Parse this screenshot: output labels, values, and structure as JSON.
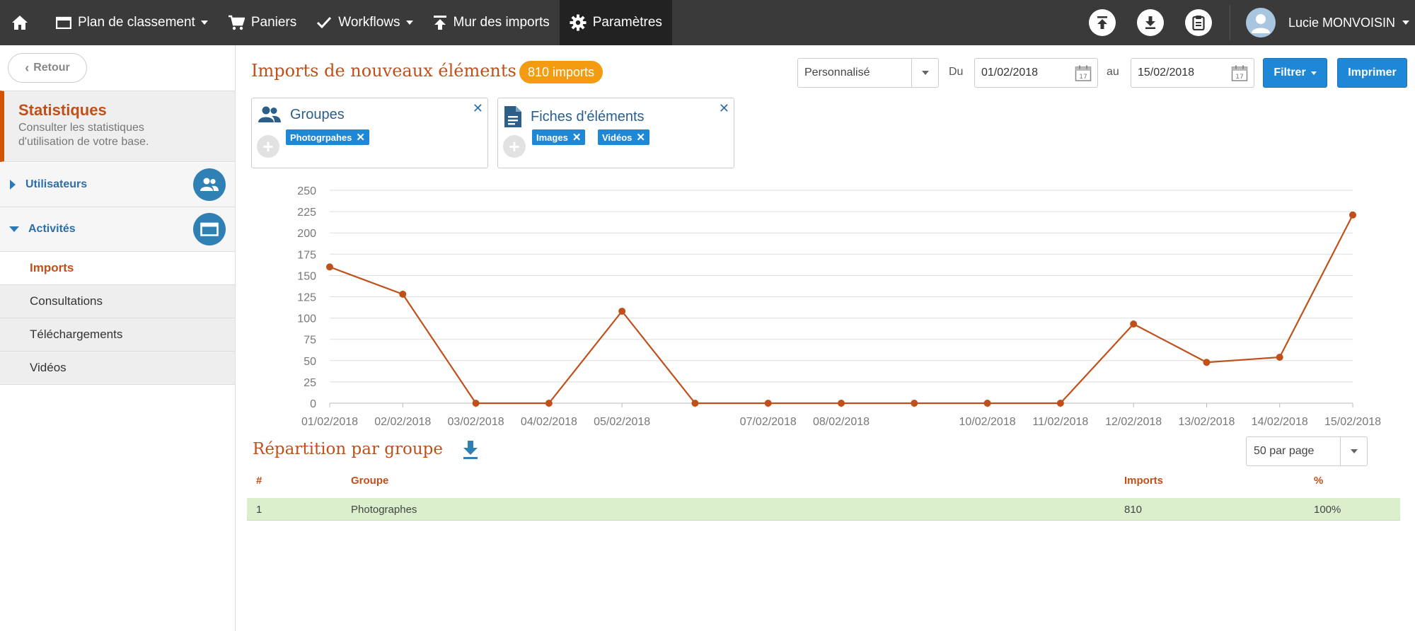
{
  "topbar": {
    "items": [
      {
        "label": "Plan de classement",
        "dropdown": true
      },
      {
        "label": "Paniers"
      },
      {
        "label": "Workflows",
        "dropdown": true
      },
      {
        "label": "Mur des imports"
      },
      {
        "label": "Paramètres",
        "active": true
      }
    ],
    "user_name": "Lucie MONVOISIN"
  },
  "sidebar": {
    "back_label": "Retour",
    "stat_title": "Statistiques",
    "stat_subtitle": "Consulter les statistiques d'utilisation de votre base.",
    "sections": [
      {
        "label": "Utilisateurs",
        "expanded": false,
        "icon": "users-icon"
      },
      {
        "label": "Activités",
        "expanded": true,
        "icon": "folder-icon"
      }
    ],
    "sub_items": [
      {
        "label": "Imports",
        "active": true
      },
      {
        "label": "Consultations"
      },
      {
        "label": "Téléchargements"
      },
      {
        "label": "Vidéos"
      }
    ]
  },
  "main": {
    "title": "Imports de nouveaux éléments",
    "badge": "810 imports",
    "period_select": "Personnalisé",
    "from_label": "Du",
    "from_date": "01/02/2018",
    "to_label": "au",
    "to_date": "15/02/2018",
    "filter_button": "Filtrer",
    "print_button": "Imprimer"
  },
  "filters": [
    {
      "title": "Groupes",
      "tags": [
        "Photogrpahes"
      ]
    },
    {
      "title": "Fiches d'éléments",
      "tags": [
        "Images",
        "Vidéos"
      ]
    }
  ],
  "chart_data": {
    "type": "line",
    "title": "",
    "xlabel": "",
    "ylabel": "",
    "ylim": [
      0,
      250
    ],
    "yticks": [
      0,
      25,
      50,
      75,
      100,
      125,
      150,
      175,
      200,
      225,
      250
    ],
    "grid": true,
    "legend": "none",
    "color": "#c0501a",
    "x": [
      "01/02/2018",
      "02/02/2018",
      "03/02/2018",
      "04/02/2018",
      "05/02/2018",
      "06/02/2018",
      "07/02/2018",
      "08/02/2018",
      "09/02/2018",
      "10/02/2018",
      "11/02/2018",
      "12/02/2018",
      "13/02/2018",
      "14/02/2018",
      "15/02/2018"
    ],
    "x_tick_labels": [
      "01/02/2018",
      "02/02/2018",
      "03/02/2018",
      "04/02/2018",
      "05/02/2018",
      "",
      "07/02/2018",
      "08/02/2018",
      "",
      "10/02/2018",
      "11/02/2018",
      "12/02/2018",
      "13/02/2018",
      "14/02/2018",
      "15/02/2018"
    ],
    "values": [
      160,
      128,
      0,
      0,
      108,
      0,
      0,
      0,
      0,
      0,
      0,
      93,
      48,
      54,
      221
    ]
  },
  "breakdown": {
    "title": "Répartition par groupe",
    "per_page": "50 par page",
    "columns": [
      "#",
      "Groupe",
      "Imports",
      "%"
    ],
    "rows": [
      [
        "1",
        "Photographes",
        "810",
        "100%"
      ]
    ]
  }
}
